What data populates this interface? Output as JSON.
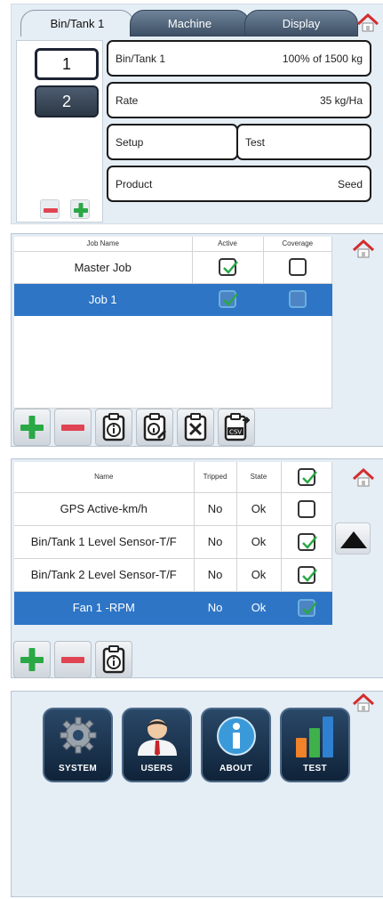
{
  "panel1": {
    "tabs": [
      {
        "label": "Bin/Tank 1"
      },
      {
        "label": "Machine"
      },
      {
        "label": "Display"
      }
    ],
    "bins": [
      "1",
      "2"
    ],
    "cards": {
      "bin_label": "Bin/Tank 1",
      "bin_value": "100% of 1500 kg",
      "rate_label": "Rate",
      "rate_value": "35 kg/Ha",
      "setup_label": "Setup",
      "test_label": "Test",
      "product_label": "Product",
      "product_value": "Seed"
    }
  },
  "panel2": {
    "headers": {
      "name": "Job Name",
      "active": "Active",
      "coverage": "Coverage"
    },
    "rows": [
      {
        "name": "Master Job",
        "active": true,
        "coverage": false
      },
      {
        "name": "Job 1",
        "active": true,
        "coverage": false,
        "selected": true
      }
    ]
  },
  "panel3": {
    "headers": {
      "name": "Name",
      "tripped": "Tripped",
      "state": "State"
    },
    "rows": [
      {
        "name": "GPS Active-km/h",
        "tripped": "No",
        "state": "Ok",
        "checked": false
      },
      {
        "name": "Bin/Tank 1 Level Sensor-T/F",
        "tripped": "No",
        "state": "Ok",
        "checked": true
      },
      {
        "name": "Bin/Tank 2 Level Sensor-T/F",
        "tripped": "No",
        "state": "Ok",
        "checked": true
      },
      {
        "name": "Fan 1 -RPM",
        "tripped": "No",
        "state": "Ok",
        "checked": true,
        "selected": true
      }
    ]
  },
  "panel4": {
    "tiles": [
      {
        "label": "SYSTEM",
        "icon": "gear-icon"
      },
      {
        "label": "USERS",
        "icon": "user-icon"
      },
      {
        "label": "ABOUT",
        "icon": "info-icon"
      },
      {
        "label": "TEST",
        "icon": "bar-chart-icon"
      }
    ]
  },
  "colors": {
    "selected_row": "#2e75c6",
    "panel_bg": "#e5edf5",
    "plus_green": "#2aa845",
    "minus_red": "#e04452",
    "home_red": "#d22e2e"
  }
}
